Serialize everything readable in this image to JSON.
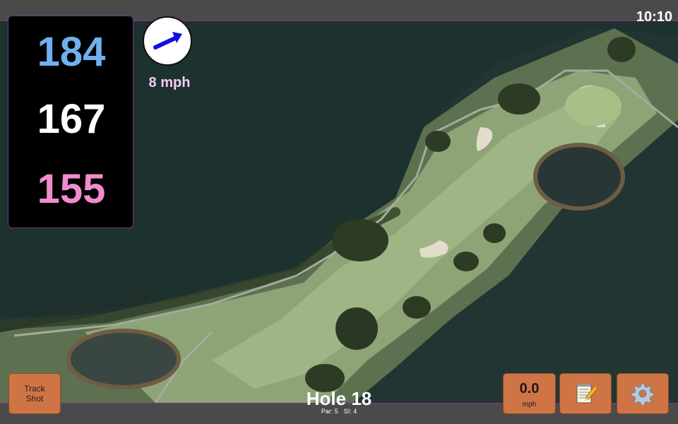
{
  "status_bar": {
    "time": "10:10"
  },
  "distances": {
    "back": "184",
    "middle": "167",
    "front": "155",
    "colors": {
      "back": "#6fb0ef",
      "middle": "#ffffff",
      "front": "#f08ccc"
    }
  },
  "wind": {
    "speed": "8 mph",
    "color": "#f6c9f6",
    "arrow_color": "#1010e0",
    "icon": "wind-direction-arrow-icon"
  },
  "track_shot": {
    "line1": "Track",
    "line2": "Shot"
  },
  "hole": {
    "title": "Hole 18",
    "par": "Par: 5",
    "si": "SI: 4"
  },
  "speed": {
    "value": "0.0",
    "unit": "mph"
  },
  "toolbar": {
    "notes_icon": "notepad-icon",
    "settings_icon": "gear-icon"
  },
  "colors": {
    "button_bg": "#cf7444",
    "panel_border": "#6b3a8a",
    "bar_bg": "#4a4a4a"
  }
}
